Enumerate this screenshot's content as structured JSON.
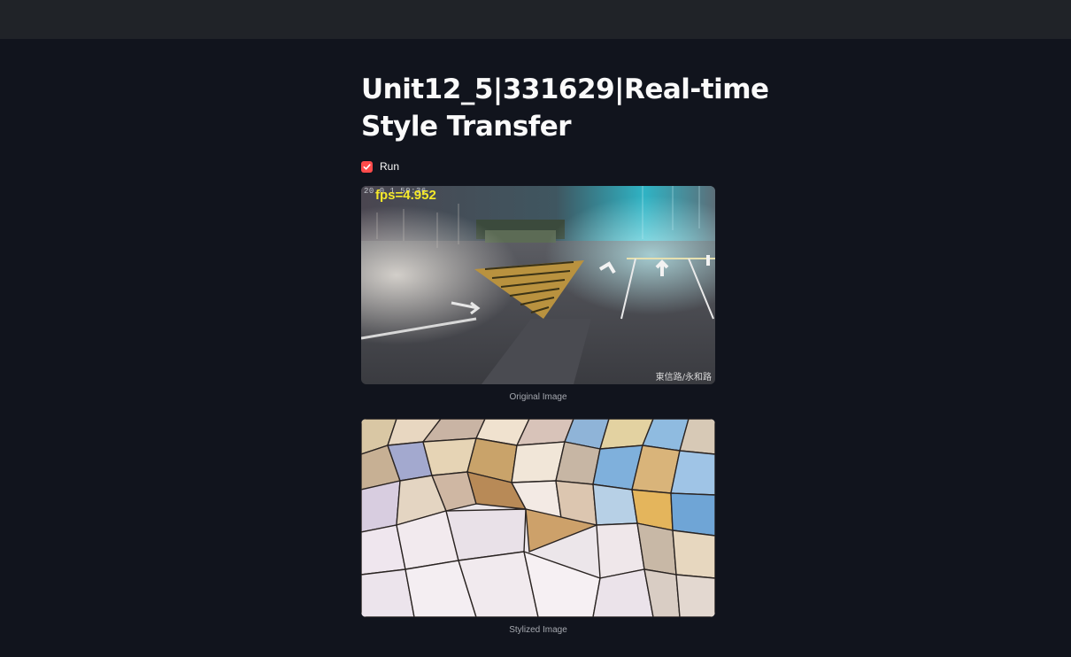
{
  "page": {
    "title": "Unit12_5|331629|Real-time Style Transfer"
  },
  "run_checkbox": {
    "label": "Run",
    "checked": true,
    "color": "#ff4b4b"
  },
  "original": {
    "caption": "Original Image",
    "fps_text": "fps=4.952",
    "timestamp_text": "20   0  1    50:36",
    "station_text": "東信路/永和路"
  },
  "stylized": {
    "caption": "Stylized Image"
  },
  "colors": {
    "background": "#11141d",
    "topbar": "#202328",
    "fps_overlay": "#f5e92a"
  }
}
